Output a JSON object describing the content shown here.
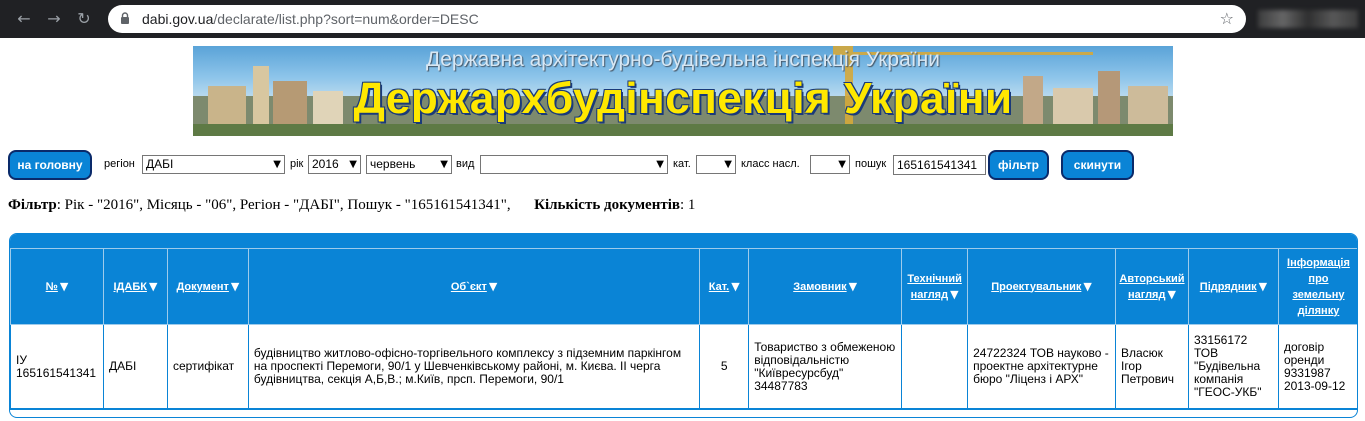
{
  "browser": {
    "url_host": "dabi.gov.ua",
    "url_path": "/declarate/list.php?sort=num&order=DESC"
  },
  "banner": {
    "subtitle": "Державна архітектурно-будівельна інспекція України",
    "title": "Держархбудінспекція України"
  },
  "filter_bar": {
    "home_button": "на головну",
    "region_label": "регіон",
    "region_value": "ДАБІ",
    "year_label": "рік",
    "year_value": "2016",
    "month_value": "червень",
    "type_label": "вид",
    "type_value": "",
    "cat_label": "кат.",
    "cat_value": "",
    "class_label": "класс насл.",
    "class_value": "",
    "search_label": "пошук",
    "search_value": "165161541341",
    "filter_button": "фільтр",
    "reset_button": "скинути"
  },
  "filter_summary": {
    "filter_label": "Фільтр",
    "filter_text": ": Рік - \"2016\", Місяць - \"06\", Регіон - \"ДАБІ\", Пошук - \"165161541341\",",
    "count_label": "Кількість документів",
    "count_value": ": 1"
  },
  "table": {
    "headers": [
      "№",
      "ІДАБК",
      "Документ",
      "Об`єкт",
      "Кат.",
      "Замовник",
      "Технічний нагляд",
      "Проектувальник",
      "Авторський нагляд",
      "Підрядник",
      "Інформація про земельну ділянку"
    ],
    "rows": [
      {
        "num": "ІУ 165161541341",
        "idabk": "ДАБІ",
        "document": "сертифікат",
        "object": "будівництво житлово-офісно-торгівельного комплексу з підземним паркінгом на проспекті Перемоги, 90/1 у Шевченківському районі, м. Києва. ІІ черга будівництва, секція А,Б,В.; м.Київ, прсп. Перемоги, 90/1",
        "cat": "5",
        "customer": "Товариство з обмеженою відповідальністю \"Київресурсбуд\" 34487783",
        "tech_supervision": "",
        "designer": "24722324 ТОВ науково - проектне архітектурне бюро \"Ліценз і АРХ\"",
        "author_supervision": "Власюк Ігор Петрович",
        "contractor": "33156172 ТОВ \"Будівельна компанія \"ГЕОС-УКБ\"",
        "land_info": "договір оренди 9331987 2013-09-12"
      }
    ]
  }
}
